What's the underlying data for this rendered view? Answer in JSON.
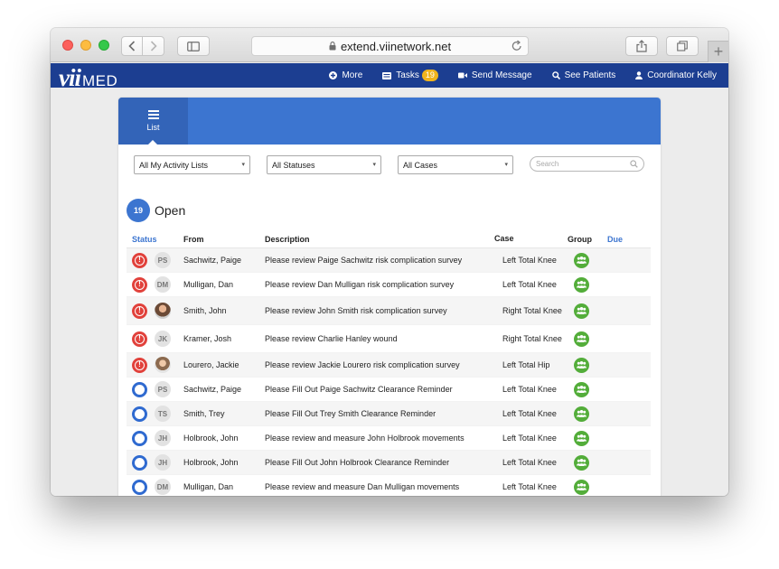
{
  "browser": {
    "url": "extend.viinetwork.net"
  },
  "brand": {
    "vii": "vii",
    "med": "MED"
  },
  "topnav": {
    "more": "More",
    "tasks": "Tasks",
    "tasks_count": "19",
    "send_message": "Send Message",
    "see_patients": "See Patients",
    "user": "Coordinator Kelly"
  },
  "view_tab": {
    "label": "List"
  },
  "filters": {
    "lists": "All My Activity Lists",
    "statuses": "All Statuses",
    "cases": "All Cases",
    "search_placeholder": "Search"
  },
  "open_section": {
    "count": "19",
    "label": "Open"
  },
  "table": {
    "headers": {
      "status": "Status",
      "from": "From",
      "description": "Description",
      "case": "Case",
      "group": "Group",
      "due": "Due"
    },
    "rows": [
      {
        "status": "urgent",
        "initials": "PS",
        "from": "Sachwitz, Paige",
        "description": "Please review Paige Sachwitz risk complication survey",
        "case": "Left Total Knee"
      },
      {
        "status": "urgent",
        "initials": "DM",
        "from": "Mulligan, Dan",
        "description": "Please review Dan Mulligan risk complication survey",
        "case": "Left Total Knee"
      },
      {
        "status": "urgent",
        "initials": "",
        "from": "Smith, John",
        "description": "Please review John Smith risk complication survey",
        "case": "Right Total Knee"
      },
      {
        "status": "urgent",
        "initials": "JK",
        "from": "Kramer, Josh",
        "description": "Please review Charlie Hanley wound",
        "case": "Right Total Knee"
      },
      {
        "status": "urgent",
        "initials": "",
        "from": "Lourero, Jackie",
        "description": "Please review Jackie Lourero risk complication survey",
        "case": "Left Total Hip"
      },
      {
        "status": "open",
        "initials": "PS",
        "from": "Sachwitz, Paige",
        "description": "Please Fill Out Paige Sachwitz Clearance Reminder",
        "case": "Left Total Knee"
      },
      {
        "status": "open",
        "initials": "TS",
        "from": "Smith, Trey",
        "description": "Please Fill Out Trey Smith Clearance Reminder",
        "case": "Left Total Knee"
      },
      {
        "status": "open",
        "initials": "JH",
        "from": "Holbrook, John",
        "description": "Please review and measure John Holbrook movements",
        "case": "Left Total Knee"
      },
      {
        "status": "open",
        "initials": "JH",
        "from": "Holbrook, John",
        "description": "Please Fill Out John Holbrook Clearance Reminder",
        "case": "Left Total Knee"
      },
      {
        "status": "open",
        "initials": "DM",
        "from": "Mulligan, Dan",
        "description": "Please review and measure Dan Mulligan movements",
        "case": "Left Total Knee"
      }
    ]
  },
  "colors": {
    "navbar": "#1c3e91",
    "panel_header": "#3c75d0",
    "urgent": "#e1413b",
    "open": "#2f6ad0",
    "group": "#53ad3a",
    "tasks_badge": "#f0b41c"
  }
}
